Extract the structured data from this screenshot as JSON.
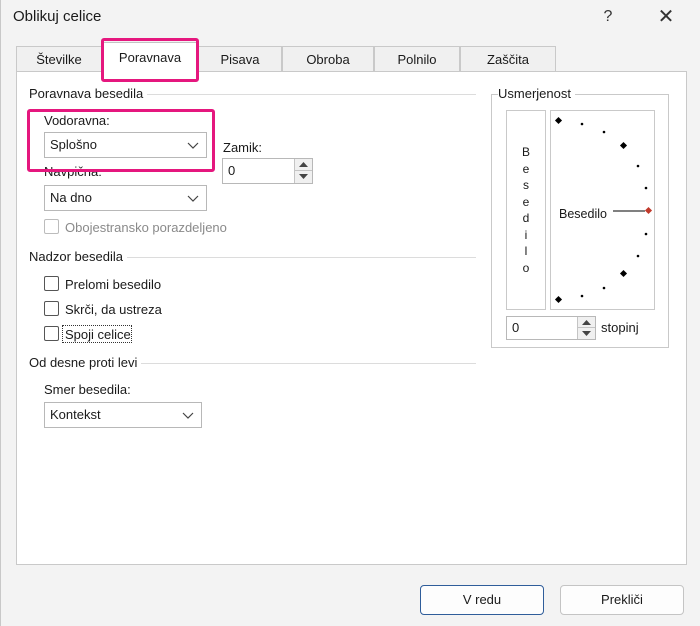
{
  "window": {
    "title": "Oblikuj celice",
    "help_label": "?",
    "close_label": "✕"
  },
  "tabs": [
    {
      "label": "Številke"
    },
    {
      "label": "Poravnava"
    },
    {
      "label": "Pisava"
    },
    {
      "label": "Obroba"
    },
    {
      "label": "Polnilo"
    },
    {
      "label": "Zaščita"
    }
  ],
  "alignment": {
    "group_label": "Poravnava besedila",
    "horizontal": {
      "label": "Vodoravna:",
      "value": "Splošno"
    },
    "indent": {
      "label": "Zamik:",
      "value": "0"
    },
    "vertical": {
      "label": "Navpična:",
      "value": "Na dno"
    },
    "justify_distributed": {
      "label": "Obojestransko porazdeljeno",
      "checked": false,
      "disabled": true
    }
  },
  "text_control": {
    "group_label": "Nadzor besedila",
    "wrap": {
      "label": "Prelomi besedilo",
      "checked": false
    },
    "shrink": {
      "label": "Skrči, da ustreza",
      "checked": false
    },
    "merge": {
      "label": "Spoji celice",
      "checked": false
    }
  },
  "rtl": {
    "group_label": "Od desne proti levi",
    "direction": {
      "label": "Smer besedila:",
      "value": "Kontekst"
    }
  },
  "orientation": {
    "group_label": "Usmerjenost",
    "vertical_text": [
      "B",
      "e",
      "s",
      "e",
      "d",
      "i",
      "l",
      "o"
    ],
    "dial_text": "Besedilo",
    "degrees": {
      "value": "0",
      "unit": "stopinj"
    }
  },
  "footer": {
    "ok_label": "V redu",
    "cancel_label": "Prekliči"
  },
  "highlight_color": "#e5177e"
}
